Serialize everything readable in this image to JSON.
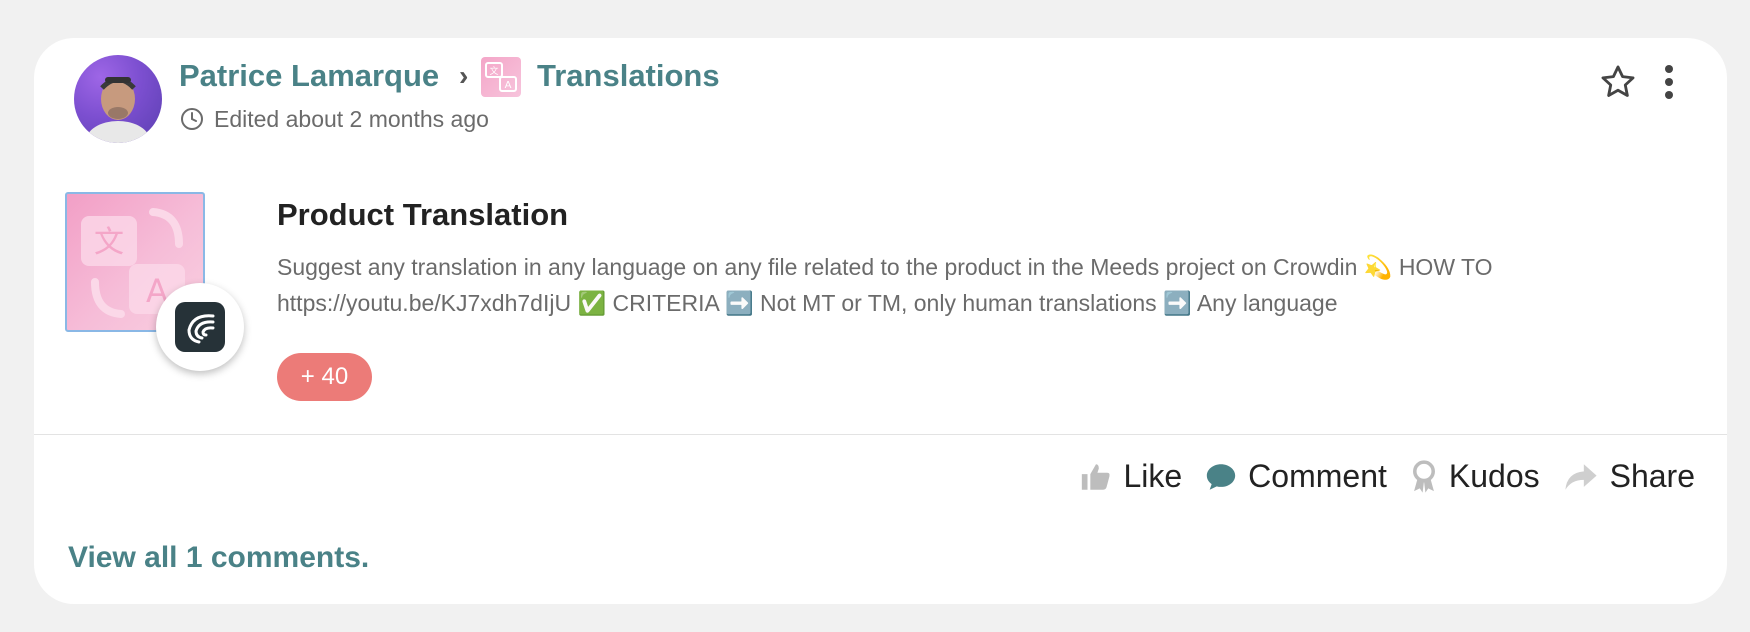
{
  "activity": {
    "author": "Patrice Lamarque",
    "separator": "›",
    "space": "Translations",
    "edited": "Edited about 2 months ago"
  },
  "program": {
    "title": "Product Translation",
    "description": "Suggest any translation in any language on any file related to the product in the Meeds project on Crowdin 💫 HOW TO https://youtu.be/KJ7xdh7dIjU ✅ CRITERIA ➡️ Not MT or TM, only human translations ➡️ Any language",
    "points": "+ 40"
  },
  "actions": {
    "like": "Like",
    "comment": "Comment",
    "kudos": "Kudos",
    "share": "Share"
  },
  "comments_link": "View all 1 comments.",
  "colors": {
    "accent": "#4a8287",
    "points_badge": "#ec7b78",
    "card_bg": "#ffffff",
    "page_bg": "#f1f1f1"
  },
  "icons": [
    "clock-icon",
    "star-icon",
    "more-vertical-icon",
    "like-icon",
    "comment-icon",
    "kudos-icon",
    "share-icon",
    "crowdin-icon",
    "translate-icon"
  ]
}
